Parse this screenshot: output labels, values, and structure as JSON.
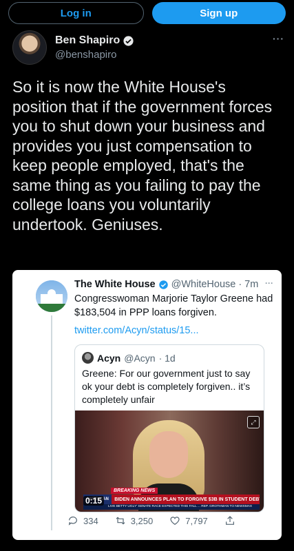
{
  "auth": {
    "login_label": "Log in",
    "signup_label": "Sign up"
  },
  "author": {
    "display_name": "Ben Shapiro",
    "handle": "@benshapiro",
    "more_label": "···"
  },
  "tweet": {
    "text": "So it is now the White House's position that if the government forces you to shut down your business and provides you just compensation to keep people employed, that's the same thing as you failing to pay the college loans you voluntarily undertook. Geniuses."
  },
  "quoted": {
    "display_name": "The White House",
    "handle": "@WhiteHouse",
    "time": "· 7m",
    "more_label": "···",
    "text": "Congresswoman Marjorie Taylor Greene had $183,504 in PPP loans forgiven.",
    "link": "twitter.com/Acyn/status/15...",
    "inner": {
      "display_name": "Acyn",
      "handle": "@Acyn",
      "time": "· 1d",
      "text": "Greene: For our government just to say ok your debt is completely forgiven.. it’s completely unfair",
      "video": {
        "time": "0:15",
        "breaking": "BREAKING NEWS",
        "network": "AMERICAN",
        "headline": "BIDEN ANNOUNCES PLAN TO FORGIVE $3B IN STUDENT DEBT",
        "ticker": "LIVE   BETTY UGLY' SENATE RACE EXPECTED THIS FALL ...   REP. GROTHMAN TO NEWSMAX"
      }
    },
    "actions": {
      "replies": "334",
      "retweets": "3,250",
      "likes": "7,797"
    }
  },
  "colors": {
    "background": "#000000",
    "accent": "#1d9bf0",
    "text_primary": "#e7e9ea",
    "text_secondary": "#8b98a5"
  },
  "icons": [
    "verified-badge-icon",
    "more-icon",
    "reply-icon",
    "retweet-icon",
    "like-icon",
    "share-icon",
    "expand-icon"
  ]
}
